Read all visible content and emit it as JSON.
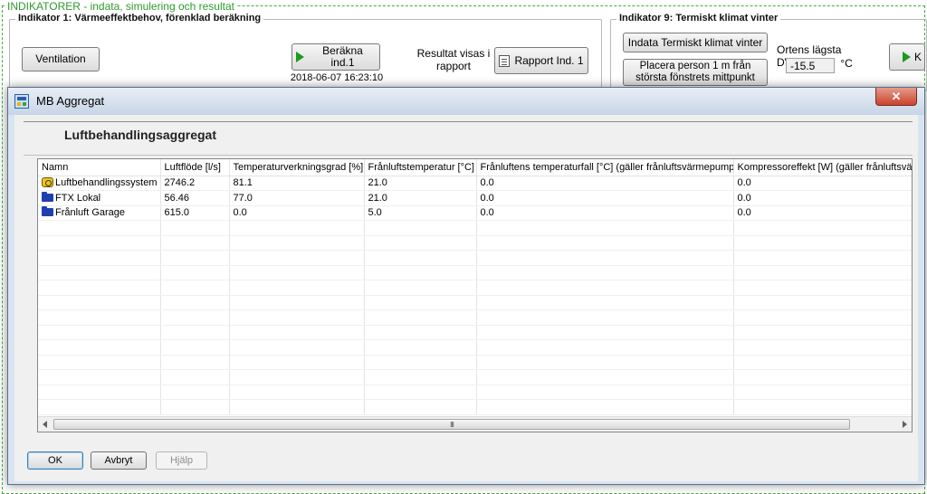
{
  "background": {
    "frame_title": "INDIKATORER - indata, simulering och resultat",
    "group1": {
      "title": "Indikator 1: Värmeeffektbehov, förenklad beräkning",
      "ventilation_label": "Ventilation",
      "calc_label": "Beräkna ind.1",
      "calc_timestamp": "2018-06-07  16:23:10",
      "result_text": "Resultat visas i rapport",
      "report_label": "Rapport Ind. 1"
    },
    "group9": {
      "title": "Indikator 9: Termiskt klimat vinter",
      "indata_label": "Indata Termiskt klimat vinter",
      "place_label": "Placera person 1 m från största fönstrets mittpunkt",
      "dvut_label": "Ortens lägsta DVUT",
      "dvut_value": "-15.5",
      "dvut_unit": "°C",
      "partial_btn_label": "K"
    }
  },
  "dialog": {
    "title": "MB Aggregat",
    "close_label": "✕",
    "section_title": "Luftbehandlingsaggregat",
    "columns": [
      "Namn",
      "Luftflöde [l/s]",
      "Temperaturverkningsgrad [%]",
      "Frånluftstemperatur [°C]",
      "Frånluftens temperaturfall [°C] (gäller frånluftsvärmepump)",
      "Kompressoreffekt [W] (gäller frånluftsvärmepump)"
    ],
    "rows": [
      {
        "icon": "air-handling-unit-icon",
        "name": "Luftbehandlingssystem",
        "flow": "2746.2",
        "efficiency": "81.1",
        "exhaust_temp": "21.0",
        "temp_drop": "0.0",
        "compressor": "0.0"
      },
      {
        "icon": "folder-icon",
        "name": "FTX Lokal",
        "flow": "56.46",
        "efficiency": "77.0",
        "exhaust_temp": "21.0",
        "temp_drop": "0.0",
        "compressor": "0.0"
      },
      {
        "icon": "folder-icon",
        "name": "Frånluft Garage",
        "flow": "615.0",
        "efficiency": "0.0",
        "exhaust_temp": "5.0",
        "temp_drop": "0.0",
        "compressor": "0.0"
      }
    ],
    "scroll_thumb_grip": "III",
    "buttons": {
      "ok": "OK",
      "cancel": "Avbryt",
      "help": "Hjälp"
    }
  }
}
